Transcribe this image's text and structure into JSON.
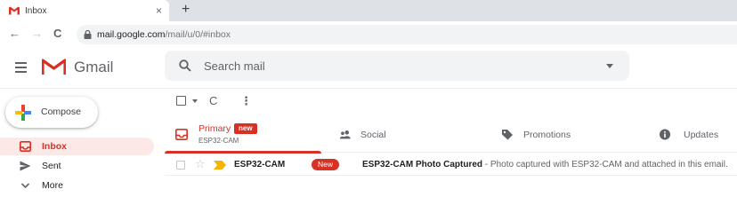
{
  "browser": {
    "tab_title": "Inbox",
    "tab_close": "×",
    "new_tab": "+",
    "back": "←",
    "forward": "→",
    "reload": "C",
    "url_host": "mail.google.com",
    "url_path": "/mail/u/0/#inbox"
  },
  "header": {
    "app_name": "Gmail",
    "search_placeholder": "Search mail"
  },
  "compose": {
    "label": "Compose"
  },
  "sidebar": {
    "items": [
      {
        "label": "Inbox",
        "icon": "inbox-icon",
        "active": true
      },
      {
        "label": "Sent",
        "icon": "send-icon",
        "active": false
      },
      {
        "label": "More",
        "icon": "chevron-down-icon",
        "active": false
      }
    ]
  },
  "toolbar": {
    "refresh": "C",
    "more": "⋮"
  },
  "tabs": [
    {
      "label": "Primary",
      "badge": "new",
      "subtitle": "ESP32-CAM",
      "icon": "inbox-icon"
    },
    {
      "label": "Social",
      "icon": "people-icon"
    },
    {
      "label": "Promotions",
      "icon": "tag-icon"
    },
    {
      "label": "Updates",
      "icon": "info-icon"
    }
  ],
  "emails": [
    {
      "sender": "ESP32-CAM",
      "badge": "New",
      "subject": "ESP32-CAM Photo Captured",
      "separator": " - ",
      "snippet": "Photo captured with ESP32-CAM and attached in this email.",
      "starred": false,
      "important": true
    }
  ],
  "colors": {
    "accent_red": "#d93025",
    "active_bg": "#fce8e6",
    "important_yellow": "#f4b400"
  }
}
